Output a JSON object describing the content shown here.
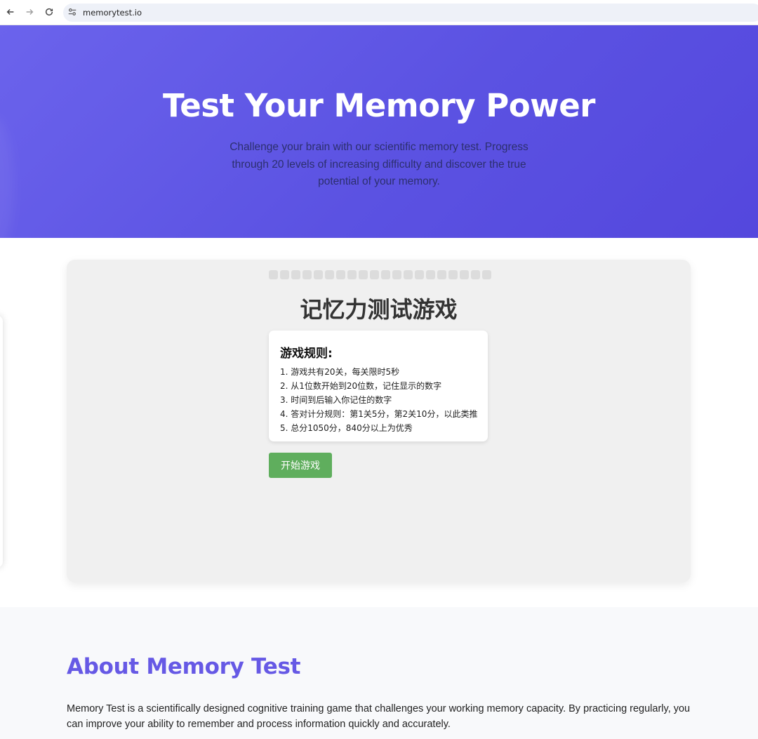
{
  "browser": {
    "url": "memorytest.io"
  },
  "hero": {
    "title": "Test Your Memory Power",
    "subtitle": "Challenge your brain with our scientific memory test. Progress through 20 levels of increasing difficulty and discover the true potential of your memory."
  },
  "game": {
    "level_count": 20,
    "title": "记忆力测试游戏",
    "rules_title": "游戏规则:",
    "rules": [
      "1. 游戏共有20关，每关限时5秒",
      "2. 从1位数开始到20位数，记住显示的数字",
      "3. 时间到后输入你记住的数字",
      "4. 答对计分规则：第1关5分，第2关10分，以此类推",
      "5. 总分1050分，840分以上为优秀"
    ],
    "start_label": "开始游戏"
  },
  "about": {
    "title": "About Memory Test",
    "text": "Memory Test is a scientifically designed cognitive training game that challenges your working memory capacity. By practicing regularly, you can improve your ability to remember and process information quickly and accurately."
  },
  "colors": {
    "hero_start": "#6b63ec",
    "hero_end": "#5447dd",
    "start_button": "#5fae5d",
    "about_title": "#6659e5"
  }
}
